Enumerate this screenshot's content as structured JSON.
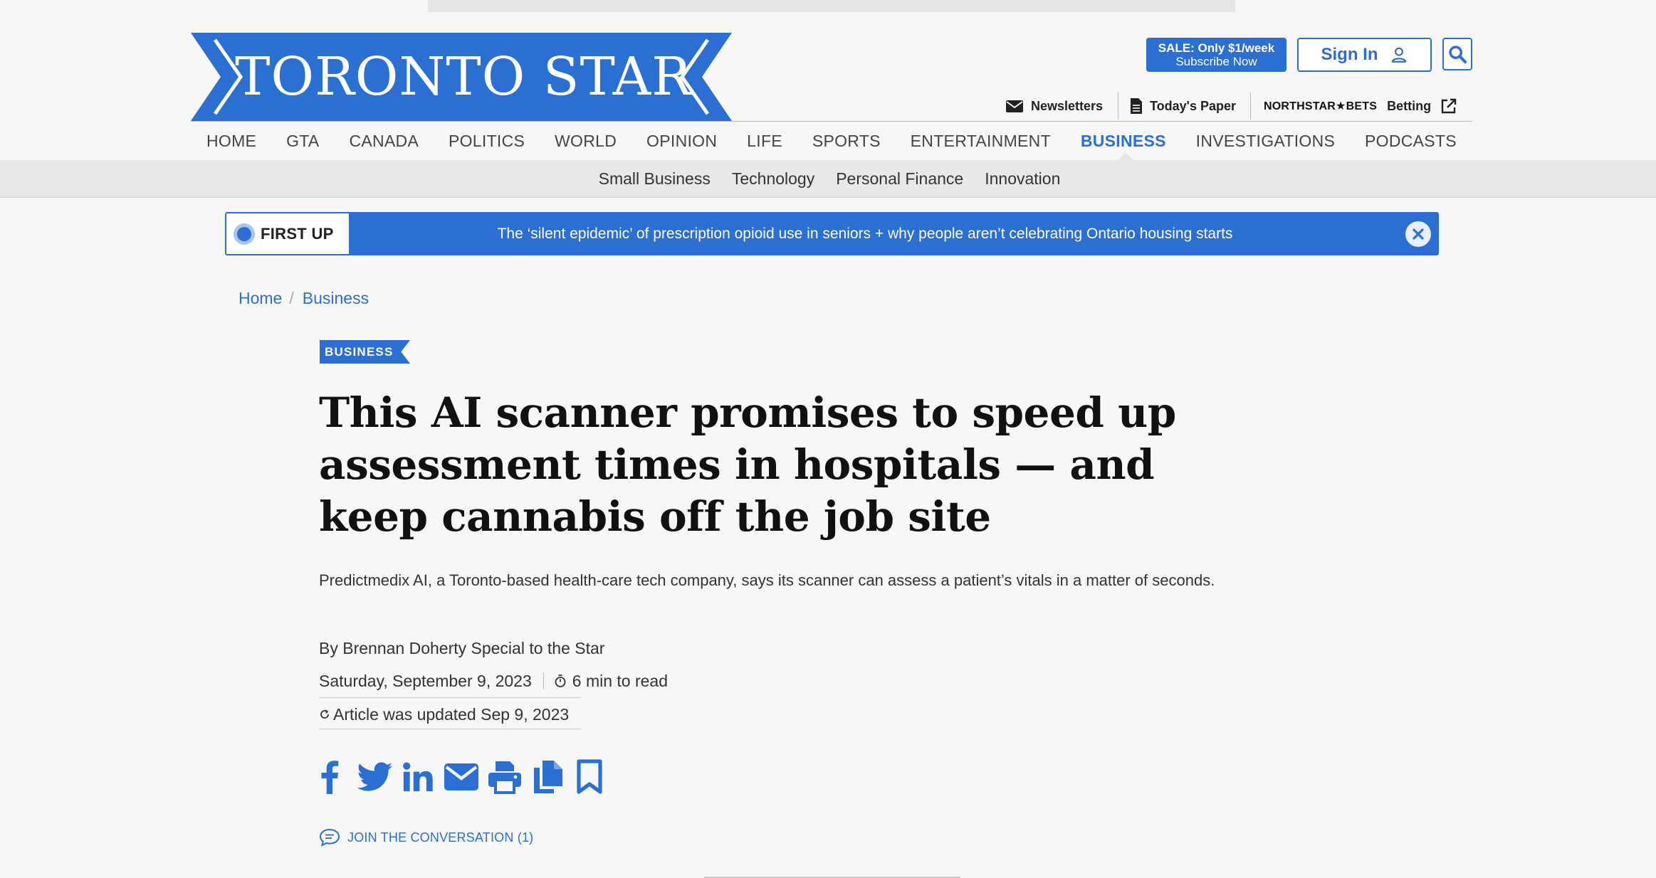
{
  "brand": {
    "name": "TORONTO STAR",
    "color": "#2a6fd1"
  },
  "header": {
    "sale": {
      "line1": "SALE: Only $1/week",
      "line2": "Subscribe Now"
    },
    "sign_in": "Sign In",
    "utility_links": {
      "newsletters": "Newsletters",
      "todays_paper": "Today's Paper",
      "northstar_bets": "NORTHSTAR★BETS",
      "betting": "Betting"
    }
  },
  "main_nav": [
    {
      "label": "HOME"
    },
    {
      "label": "GTA"
    },
    {
      "label": "CANADA"
    },
    {
      "label": "POLITICS"
    },
    {
      "label": "WORLD"
    },
    {
      "label": "OPINION"
    },
    {
      "label": "LIFE"
    },
    {
      "label": "SPORTS"
    },
    {
      "label": "ENTERTAINMENT"
    },
    {
      "label": "BUSINESS",
      "active": true
    },
    {
      "label": "INVESTIGATIONS"
    },
    {
      "label": "PODCASTS"
    }
  ],
  "sub_nav": [
    "Small Business",
    "Technology",
    "Personal Finance",
    "Innovation"
  ],
  "first_up": {
    "label": "FIRST UP",
    "headline": "The ‘silent epidemic’ of prescription opioid use in seniors + why people aren’t celebrating Ontario housing starts"
  },
  "breadcrumb": [
    "Home",
    "Business"
  ],
  "article": {
    "section": "BUSINESS",
    "headline": "This AI scanner promises to speed up assessment times in hospitals — and keep cannabis off the job site",
    "dek": "Predictmedix AI, a Toronto-based health-care tech company, says its scanner can assess a patient’s vitals in a matter of seconds.",
    "byline": "By Brennan Doherty Special to the Star",
    "date": "Saturday, September 9, 2023",
    "read_time": "6 min to read",
    "updated": "Article was updated Sep 9, 2023",
    "conversation": "JOIN THE CONVERSATION (1)"
  },
  "share_icons": [
    "facebook-icon",
    "twitter-icon",
    "linkedin-icon",
    "email-icon",
    "print-icon",
    "copy-icon",
    "bookmark-icon"
  ]
}
